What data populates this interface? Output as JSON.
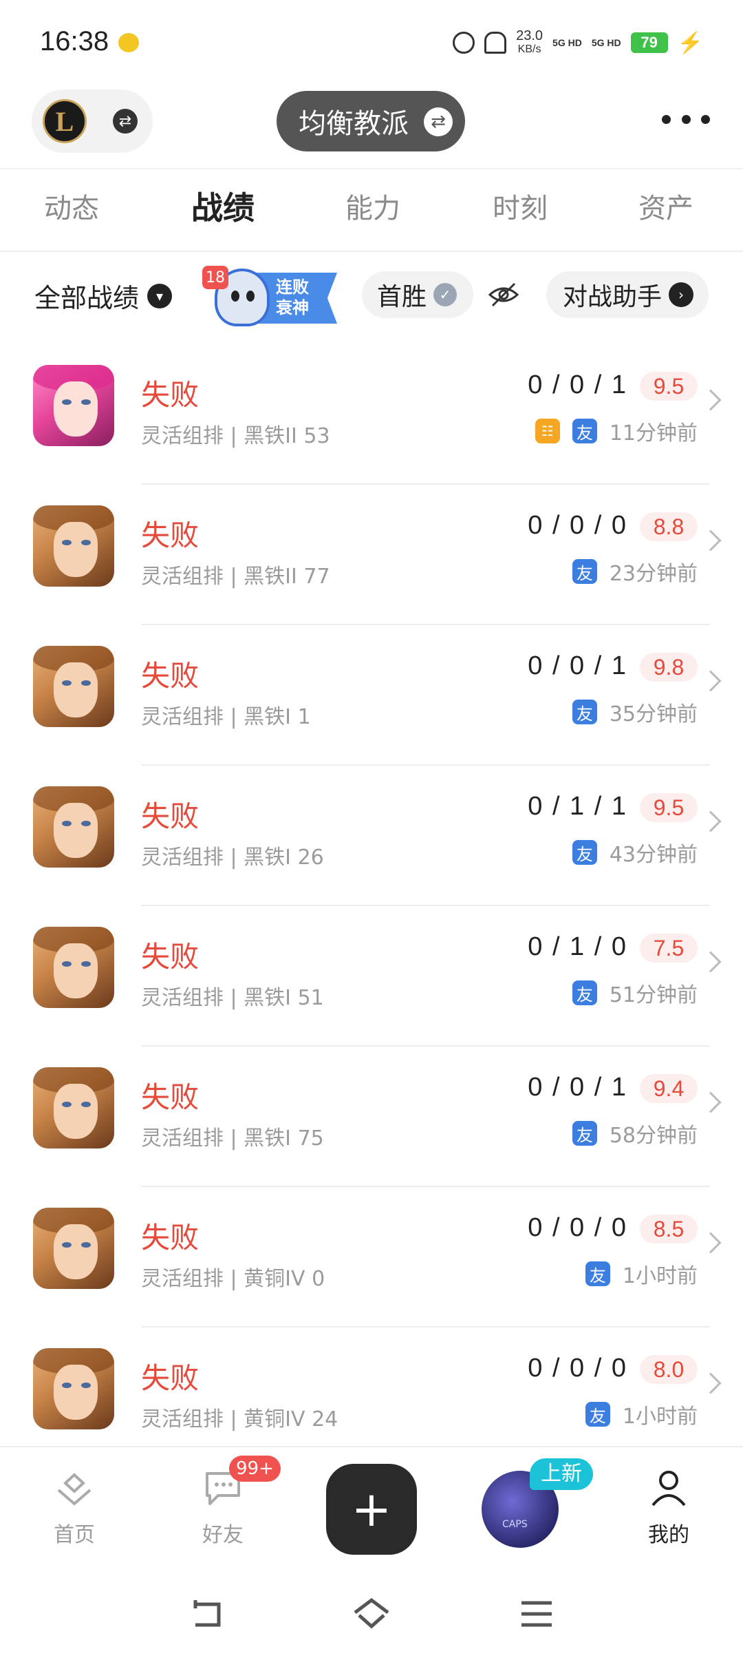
{
  "status_bar": {
    "time": "16:38",
    "net_speed": "23.0",
    "net_unit": "KB/s",
    "sim1": "5G HD",
    "sim2": "5G HD",
    "battery": "79"
  },
  "header": {
    "logo_letter": "L",
    "mode": "均衡教派"
  },
  "tabs": [
    {
      "label": "动态",
      "active": false
    },
    {
      "label": "战绩",
      "active": true
    },
    {
      "label": "能力",
      "active": false
    },
    {
      "label": "时刻",
      "active": false
    },
    {
      "label": "资产",
      "active": false
    }
  ],
  "filters": {
    "all_records": "全部战绩",
    "streak_count": "18",
    "streak_line1": "连败",
    "streak_line2": "衰神",
    "first_win": "首胜",
    "assistant": "对战助手"
  },
  "matches": [
    {
      "result": "失败",
      "mode": "灵活组排 | 黑铁II 53",
      "kda": "0 / 0 / 1",
      "score": "9.5",
      "friend_tag": "友",
      "team_tag": true,
      "time": "11分钟前",
      "champ": "pink"
    },
    {
      "result": "失败",
      "mode": "灵活组排 | 黑铁II 77",
      "kda": "0 / 0 / 0",
      "score": "8.8",
      "friend_tag": "友",
      "team_tag": false,
      "time": "23分钟前",
      "champ": "gold"
    },
    {
      "result": "失败",
      "mode": "灵活组排 | 黑铁I 1",
      "kda": "0 / 0 / 1",
      "score": "9.8",
      "friend_tag": "友",
      "team_tag": false,
      "time": "35分钟前",
      "champ": "gold"
    },
    {
      "result": "失败",
      "mode": "灵活组排 | 黑铁I 26",
      "kda": "0 / 1 / 1",
      "score": "9.5",
      "friend_tag": "友",
      "team_tag": false,
      "time": "43分钟前",
      "champ": "gold"
    },
    {
      "result": "失败",
      "mode": "灵活组排 | 黑铁I 51",
      "kda": "0 / 1 / 0",
      "score": "7.5",
      "friend_tag": "友",
      "team_tag": false,
      "time": "51分钟前",
      "champ": "gold"
    },
    {
      "result": "失败",
      "mode": "灵活组排 | 黑铁I 75",
      "kda": "0 / 0 / 1",
      "score": "9.4",
      "friend_tag": "友",
      "team_tag": false,
      "time": "58分钟前",
      "champ": "gold"
    },
    {
      "result": "失败",
      "mode": "灵活组排 | 黄铜IV 0",
      "kda": "0 / 0 / 0",
      "score": "8.5",
      "friend_tag": "友",
      "team_tag": false,
      "time": "1小时前",
      "champ": "gold"
    },
    {
      "result": "失败",
      "mode": "灵活组排 | 黄铜IV 24",
      "kda": "0 / 0 / 0",
      "score": "8.0",
      "friend_tag": "友",
      "team_tag": false,
      "time": "1小时前",
      "champ": "gold"
    }
  ],
  "bottom_nav": {
    "home": "首页",
    "friends": "好友",
    "friends_badge": "99+",
    "promo_badge": "上新",
    "promo_label": "CAPS",
    "mine": "我的"
  },
  "colors": {
    "loss_red": "#e64a3b",
    "friend_blue": "#3b7ee0",
    "promo_cyan": "#1cc3d8"
  }
}
